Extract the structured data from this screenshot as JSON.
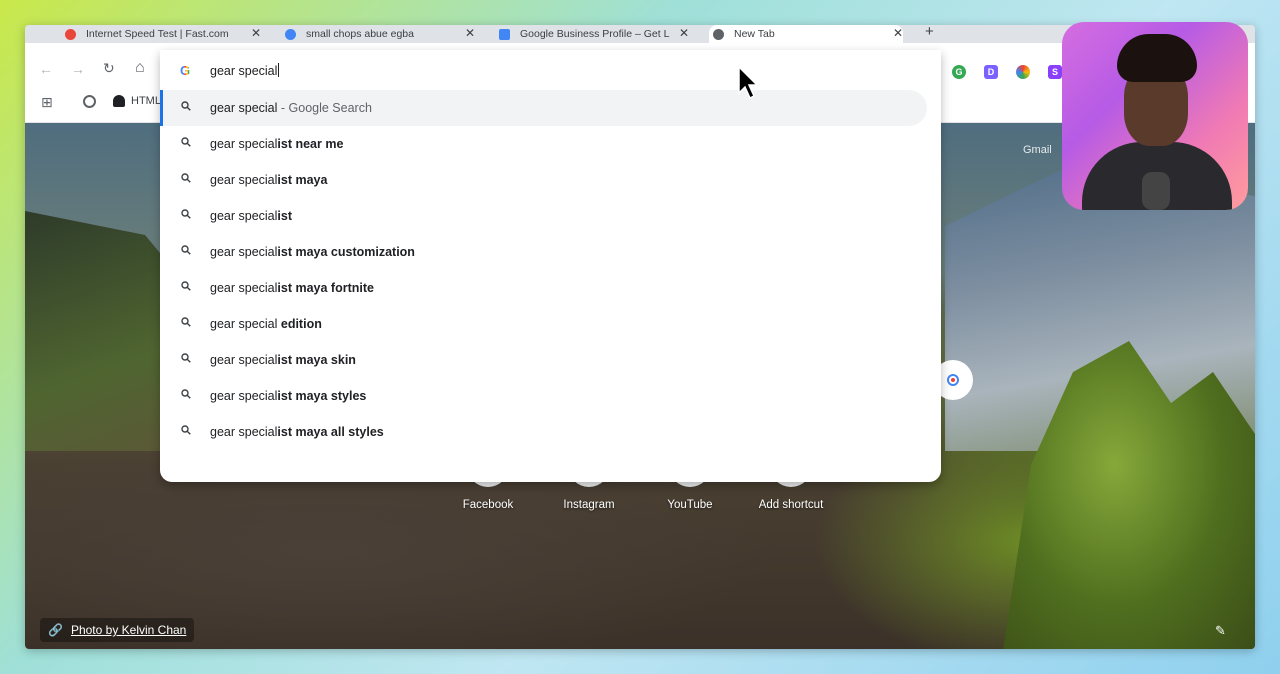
{
  "tabs": [
    {
      "title": "Internet Speed Test | Fast.com",
      "favicon_color": "#e8473a",
      "active": false
    },
    {
      "title": "small chops abue egba",
      "favicon_color": "#4285f4",
      "active": false
    },
    {
      "title": "Google Business Profile – Get L",
      "favicon_color": "#4285f4",
      "active": false
    },
    {
      "title": "New Tab",
      "favicon_color": "#5f6368",
      "active": true
    }
  ],
  "tab_close_glyph": "✕",
  "new_tab_glyph": "+",
  "toolbar": {
    "back_glyph": "←",
    "forward_glyph": "→",
    "reload_glyph": "↻",
    "home_glyph": "⌂"
  },
  "bookmarks": {
    "apps_glyph": "⊞",
    "html_label": "HTML"
  },
  "omnibox": {
    "value": "gear special"
  },
  "suggestions": [
    {
      "prefix": "gear special",
      "bold": "",
      "desc": " - Google Search",
      "selected": true
    },
    {
      "prefix": "gear special",
      "bold": "ist near me",
      "desc": "",
      "selected": false
    },
    {
      "prefix": "gear special",
      "bold": "ist maya",
      "desc": "",
      "selected": false
    },
    {
      "prefix": "gear special",
      "bold": "ist",
      "desc": "",
      "selected": false
    },
    {
      "prefix": "gear special",
      "bold": "ist maya customization",
      "desc": "",
      "selected": false
    },
    {
      "prefix": "gear special",
      "bold": "ist maya fortnite",
      "desc": "",
      "selected": false
    },
    {
      "prefix": "gear special ",
      "bold": "edition",
      "desc": "",
      "selected": false
    },
    {
      "prefix": "gear special",
      "bold": "ist maya skin",
      "desc": "",
      "selected": false
    },
    {
      "prefix": "gear special",
      "bold": "ist maya styles",
      "desc": "",
      "selected": false
    },
    {
      "prefix": "gear special",
      "bold": "ist maya all styles",
      "desc": "",
      "selected": false
    }
  ],
  "newtab": {
    "gmail": "Gmail",
    "shortcuts": [
      {
        "label": "Facebook",
        "color": "#1877f2"
      },
      {
        "label": "Instagram",
        "color": "#e1306c"
      },
      {
        "label": "YouTube",
        "color": "#ff0000"
      },
      {
        "label": "Add shortcut",
        "color": "#9aa0a6"
      }
    ],
    "photo_credit": "Photo by Kelvin Chan",
    "edit_glyph": "✎"
  },
  "colors": {
    "accent": "#1a73e8",
    "selected_bg": "#f1f3f4"
  }
}
